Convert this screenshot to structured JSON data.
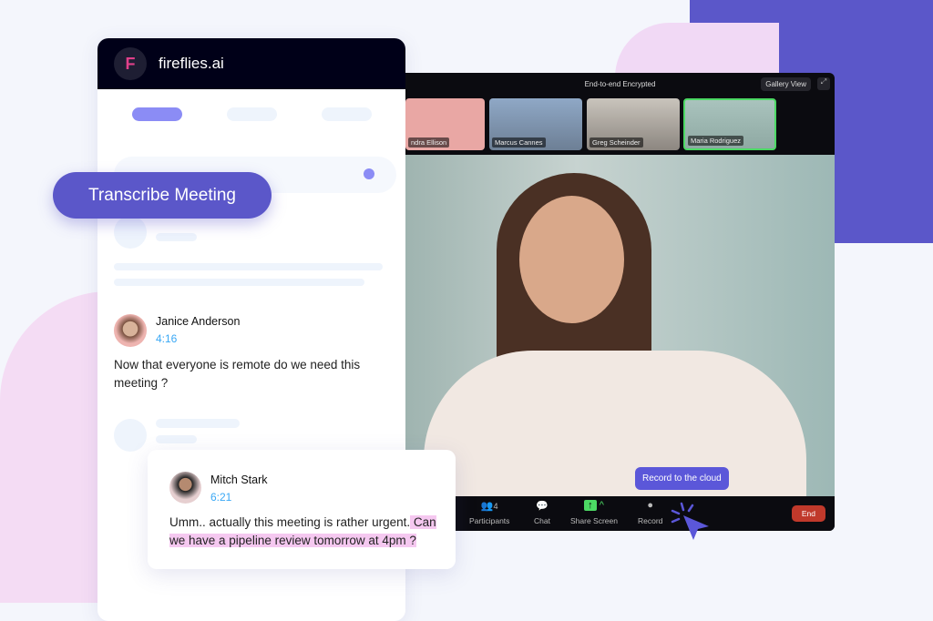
{
  "app": {
    "brand": "fireflies.ai"
  },
  "cta": {
    "label": "Transcribe Meeting"
  },
  "video": {
    "title": "End-to-end Encrypted",
    "view_button": "Gallery View",
    "thumbnails": [
      {
        "name": "ndra Ellison"
      },
      {
        "name": "Marcus Cannes"
      },
      {
        "name": "Greg Scheinder"
      },
      {
        "name": "Maria Rodriguez"
      }
    ],
    "toolbar": {
      "participants": "Participants",
      "participant_count": "4",
      "chat": "Chat",
      "share": "Share Screen",
      "record": "Record",
      "end": "End"
    },
    "tooltip": "Record to the cloud",
    "active_color": "#4cd964"
  },
  "transcript": [
    {
      "name": "Janice Anderson",
      "time": "4:16",
      "text": "Now that everyone is remote do we need this meeting ?"
    },
    {
      "name": "Mitch Stark",
      "time": "6:21",
      "text": "Umm.. actually this meeting is rather urgent.",
      "highlight": " Can we have a pipeline review tomorrow at 4pm ?"
    }
  ],
  "colors": {
    "accent": "#5b57c9",
    "highlight": "#f5c8f0",
    "time": "#3aa8f5",
    "end": "#c0392b"
  }
}
